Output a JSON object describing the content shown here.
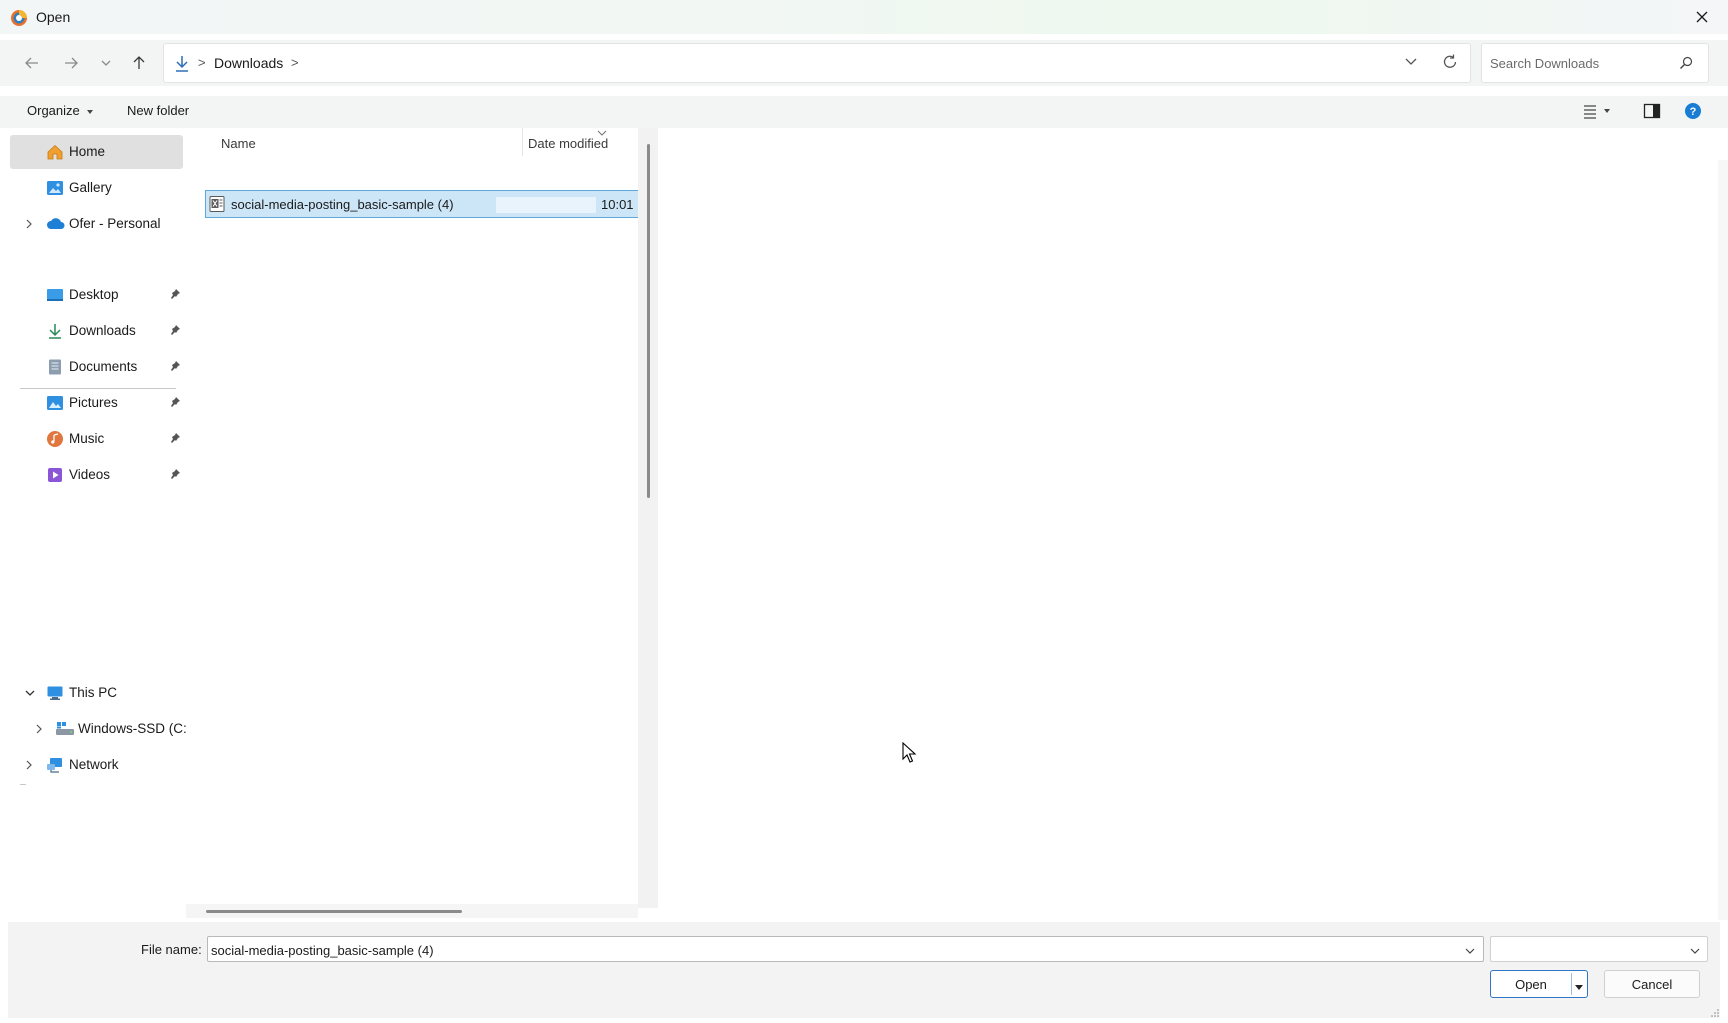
{
  "window": {
    "title": "Open"
  },
  "address": {
    "crumb": "Downloads",
    "separator": ">",
    "search_placeholder": "Search Downloads"
  },
  "toolbar": {
    "organize_label": "Organize",
    "new_folder_label": "New folder"
  },
  "navigation": {
    "items": [
      {
        "label": "Home",
        "icon": "home-icon"
      },
      {
        "label": "Gallery",
        "icon": "gallery-icon"
      },
      {
        "label": "Ofer - Personal",
        "icon": "onedrive-cloud-icon"
      },
      {
        "label": "Desktop",
        "icon": "desktop-folder-icon"
      },
      {
        "label": "Downloads",
        "icon": "download-icon"
      },
      {
        "label": "Documents",
        "icon": "documents-icon"
      },
      {
        "label": "Pictures",
        "icon": "pictures-icon"
      },
      {
        "label": "Music",
        "icon": "music-icon"
      },
      {
        "label": "Videos",
        "icon": "videos-icon"
      },
      {
        "label": "This PC",
        "icon": "computer-icon"
      },
      {
        "label": "Windows-SSD (C:",
        "icon": "drive-icon"
      },
      {
        "label": "Network",
        "icon": "network-icon"
      }
    ]
  },
  "file_list": {
    "columns": [
      "Name",
      "Date modified"
    ],
    "files": [
      {
        "name": "social-media-posting_basic-sample (4)",
        "date": "10:01",
        "icon": "excel-file-icon"
      }
    ]
  },
  "footer": {
    "file_name_label": "File name:",
    "file_name_value": "social-media-posting_basic-sample (4)",
    "open_label": "Open",
    "cancel_label": "Cancel"
  },
  "colors": {
    "accent": "#0067c0",
    "selection": "#cde6f7",
    "selection_border": "#5fa8dc"
  }
}
